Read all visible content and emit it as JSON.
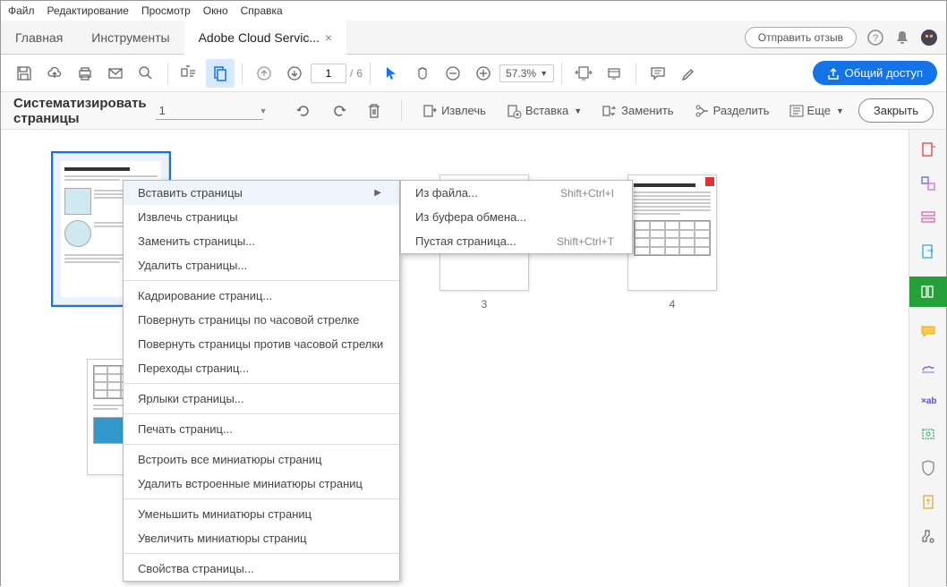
{
  "menubar": [
    "Файл",
    "Редактирование",
    "Просмотр",
    "Окно",
    "Справка"
  ],
  "tabs": {
    "home": "Главная",
    "tools": "Инструменты",
    "doc": "Adobe Cloud Servic..."
  },
  "feedback": "Отправить отзыв",
  "page_info": {
    "current": "1",
    "sep": "/",
    "total": "6"
  },
  "zoom": "57.3%",
  "share": "Общий доступ",
  "organize": {
    "title": "Систематизировать страницы",
    "page_sel": "1",
    "extract": "Извлечь",
    "insert": "Вставка",
    "replace": "Заменить",
    "split": "Разделить",
    "more": "Еще",
    "close": "Закрыть"
  },
  "thumbs": {
    "p3": "3",
    "p4": "4"
  },
  "context_menu": {
    "items": [
      {
        "label": "Вставить страницы",
        "arrow": true,
        "hover": true
      },
      {
        "label": "Извлечь страницы"
      },
      {
        "label": "Заменить страницы..."
      },
      {
        "label": "Удалить страницы..."
      },
      {
        "sep": true
      },
      {
        "label": "Кадрирование страниц..."
      },
      {
        "label": "Повернуть страницы по часовой стрелке"
      },
      {
        "label": "Повернуть страницы против часовой стрелки"
      },
      {
        "label": "Переходы страниц..."
      },
      {
        "sep": true
      },
      {
        "label": "Ярлыки страницы..."
      },
      {
        "sep": true
      },
      {
        "label": "Печать страниц..."
      },
      {
        "sep": true
      },
      {
        "label": "Встроить все миниатюры страниц"
      },
      {
        "label": "Удалить встроенные миниатюры страниц"
      },
      {
        "sep": true
      },
      {
        "label": "Уменьшить миниатюры страниц"
      },
      {
        "label": "Увеличить миниатюры страниц"
      },
      {
        "sep": true
      },
      {
        "label": "Свойства страницы..."
      }
    ]
  },
  "submenu": {
    "items": [
      {
        "label": "Из файла...",
        "shortcut": "Shift+Ctrl+I"
      },
      {
        "label": "Из буфера обмена..."
      },
      {
        "label": "Пустая страница...",
        "shortcut": "Shift+Ctrl+T"
      }
    ]
  }
}
